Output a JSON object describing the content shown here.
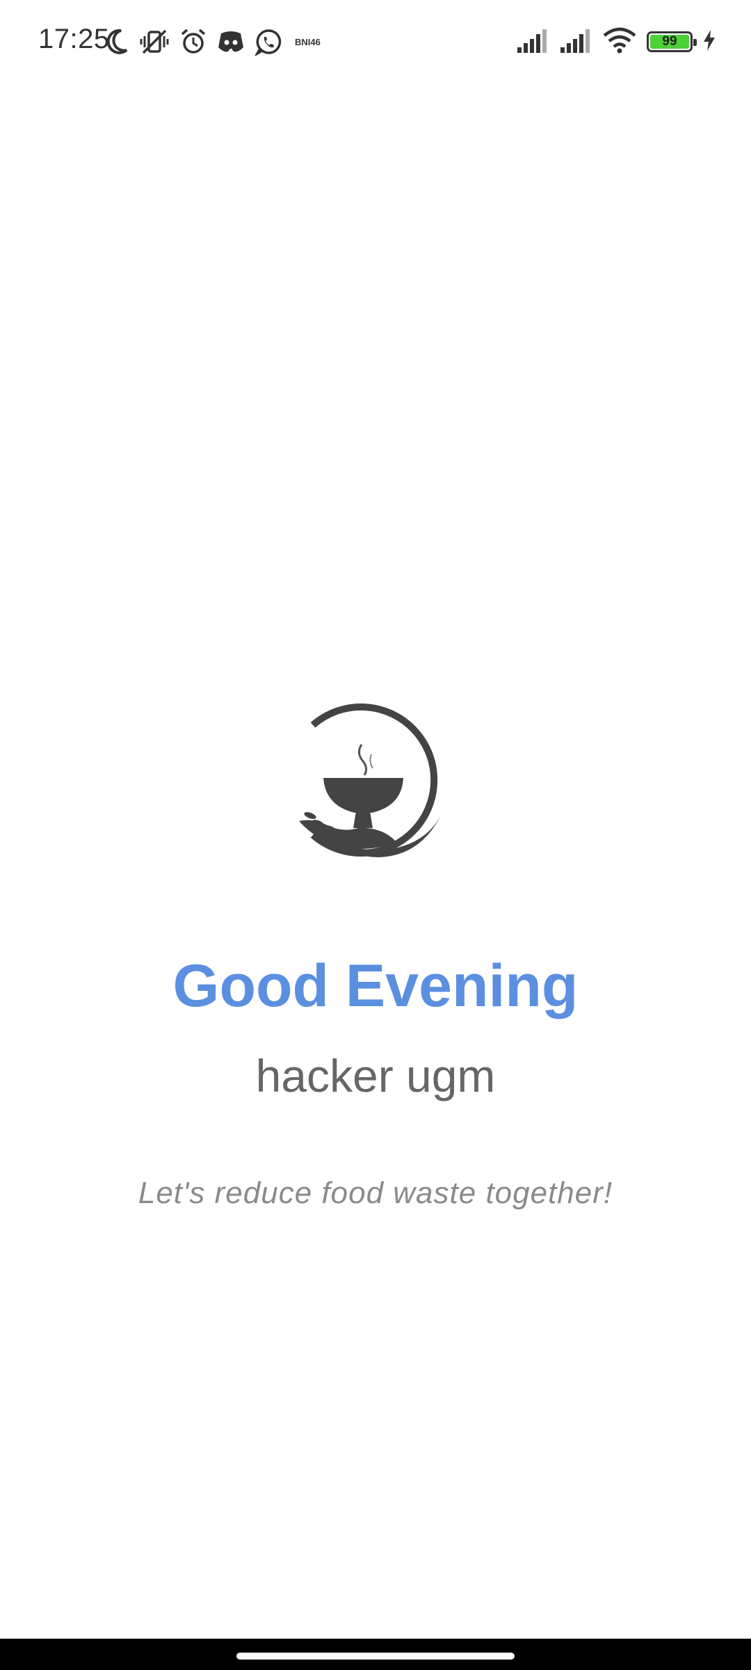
{
  "status_bar": {
    "time": "17:25",
    "carrier_tag": "BNI46",
    "battery_level": "99",
    "left_icons": [
      "moon-icon",
      "vibrate-off-icon",
      "alarm-icon",
      "discord-icon",
      "whatsapp-icon"
    ],
    "right_icons": [
      "signal-icon",
      "signal-icon",
      "wifi-icon",
      "battery-icon",
      "charging-icon"
    ],
    "battery_color": "#4cd137"
  },
  "main": {
    "logo_icon": "food-bowl-hand-logo",
    "greeting": "Good Evening",
    "username": "hacker ugm",
    "tagline": "Let's reduce food waste together!",
    "greeting_color": "#5b8fe0"
  }
}
